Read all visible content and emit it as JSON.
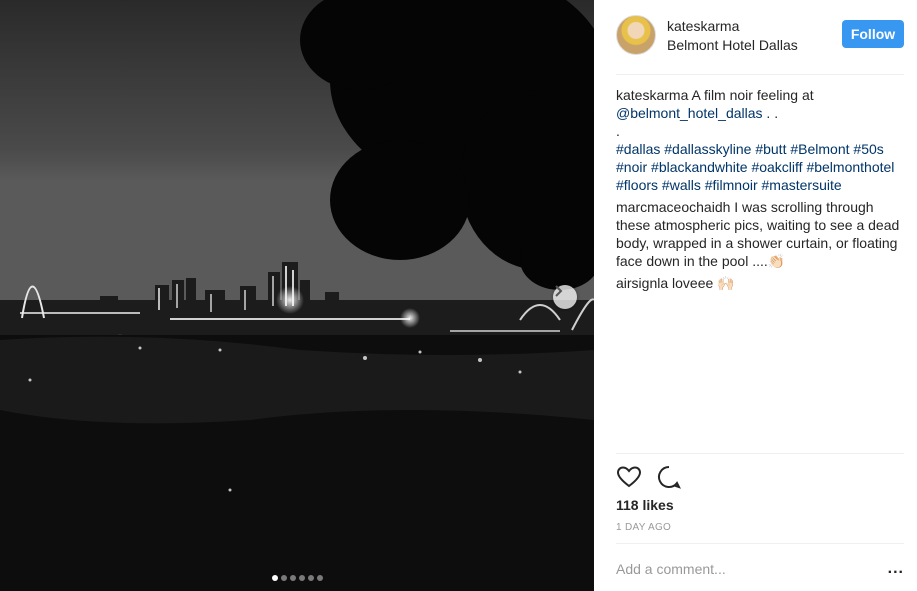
{
  "post": {
    "username": "kateskarma",
    "location": "Belmont Hotel Dallas",
    "follow_label": "Follow"
  },
  "caption": {
    "user": "kateskarma",
    "text": "A film noir feeling at",
    "mention": "@belmont_hotel_dallas",
    "after_mention": " . .",
    "dot": ".",
    "hashtags": [
      "#dallas",
      "#dallasskyline",
      "#butt",
      "#Belmont",
      "#50s",
      "#noir",
      "#blackandwhite",
      "#oakcliff",
      "#belmonthotel",
      "#floors",
      "#walls",
      "#filmnoir",
      "#mastersuite"
    ]
  },
  "comments": [
    {
      "user": "marcmaceochaidh",
      "text": "I was scrolling through these atmospheric pics, waiting to see a dead body, wrapped in a shower curtain, or floating face down in the pool ....👏🏻"
    },
    {
      "user": "airsignla",
      "text": "loveee 🙌🏻"
    }
  ],
  "stats": {
    "likes": "118 likes",
    "time": "1 DAY AGO"
  },
  "comment_box": {
    "placeholder": "Add a comment...",
    "more": "..."
  },
  "carousel": {
    "count": 6,
    "active": 0
  },
  "colors": {
    "follow": "#3897f0",
    "link": "#003569"
  },
  "icons": [
    "heart-icon",
    "comment-icon",
    "chevron-right-icon",
    "more-options-icon"
  ]
}
